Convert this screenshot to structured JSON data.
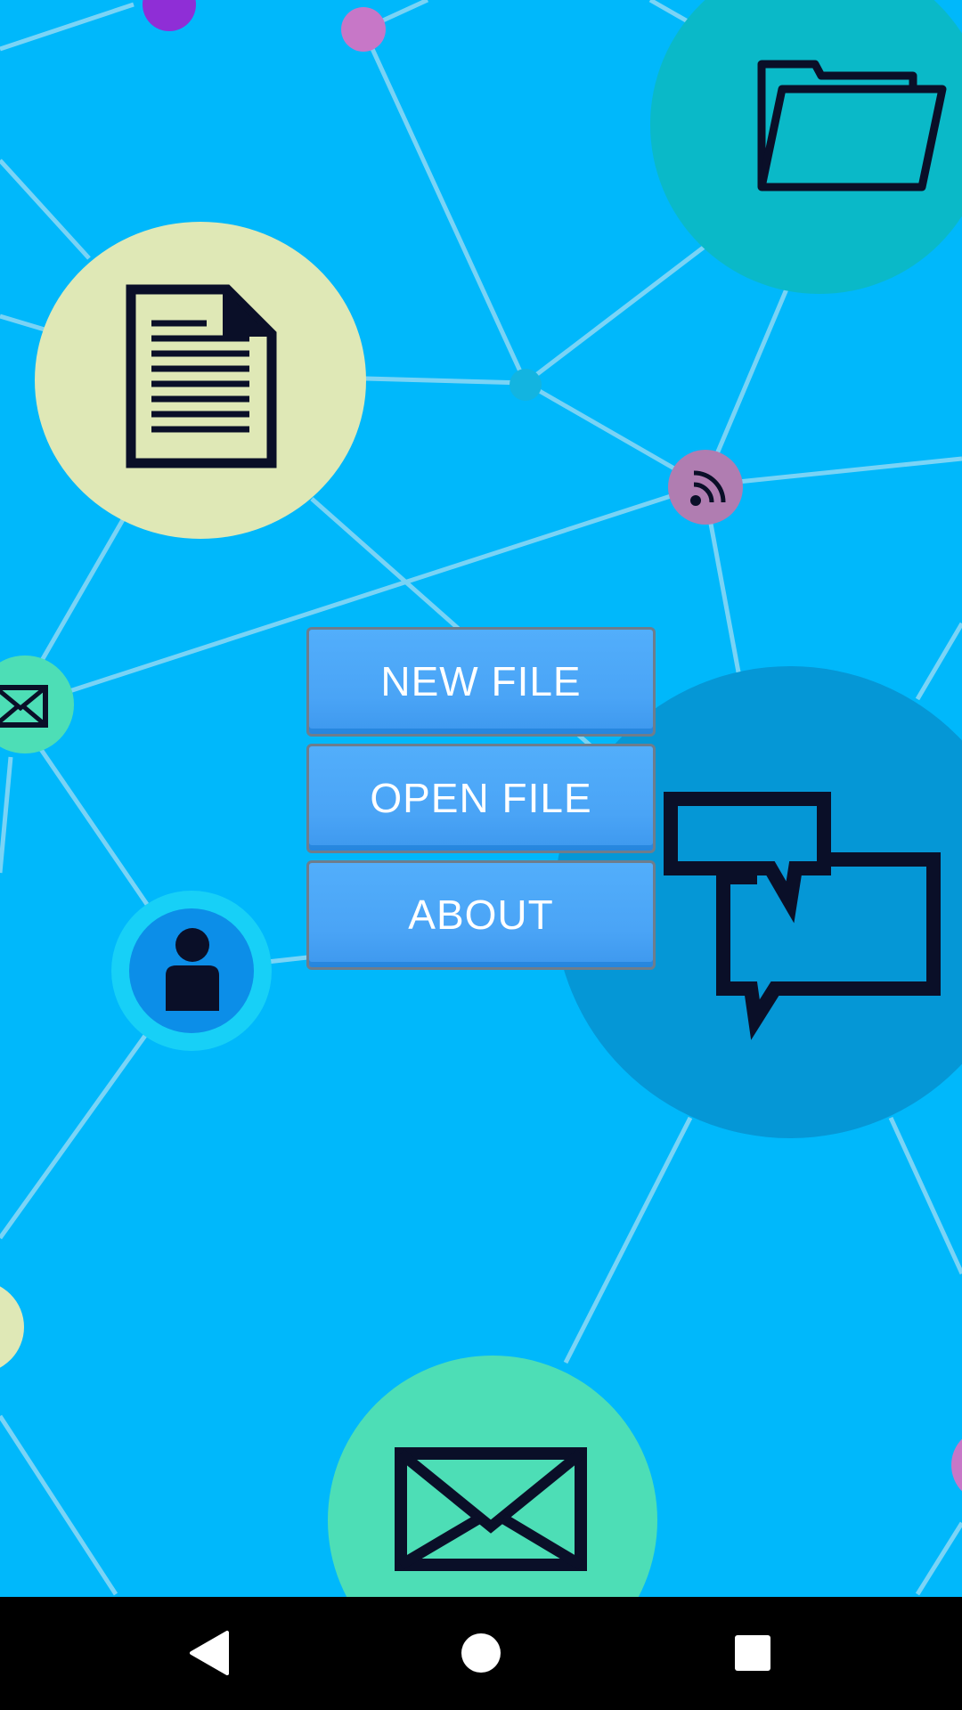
{
  "menu": {
    "new_file_label": "NEW FILE",
    "open_file_label": "OPEN FILE",
    "about_label": "ABOUT"
  },
  "background": {
    "color": "#00b8fb",
    "icons": [
      "folder-icon",
      "document-icon",
      "rss-icon",
      "mail-icon",
      "person-icon",
      "chat-icon",
      "envelope-icon"
    ]
  },
  "navigation_bar": {
    "color": "#000000",
    "icons": [
      "back-icon",
      "home-icon",
      "recents-icon"
    ]
  }
}
